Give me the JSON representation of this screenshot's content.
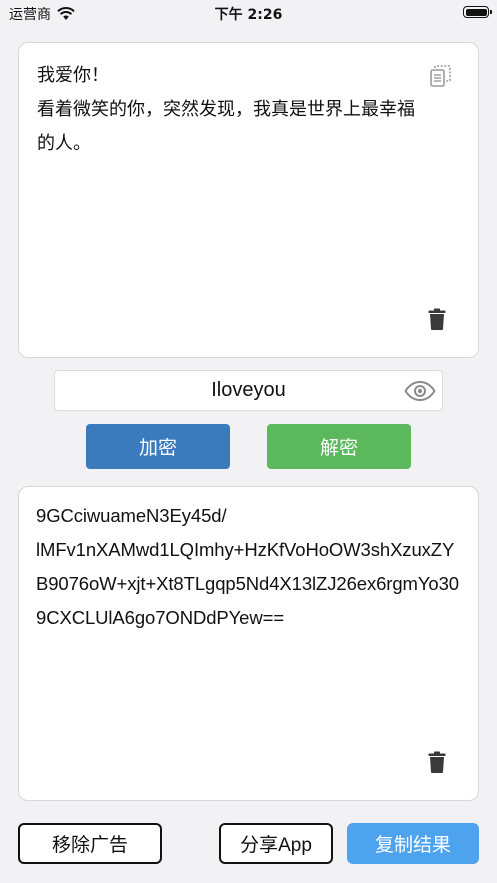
{
  "status_bar": {
    "carrier": "运营商",
    "time": "下午 2:26"
  },
  "input": {
    "text": "我爱你！\n看着微笑的你，突然发现，我真是世界上最幸福的人。",
    "copy_icon": "copy-icon",
    "delete_icon": "trash-icon"
  },
  "key": {
    "value": "Iloveyou",
    "visibility_icon": "eye-icon"
  },
  "actions": {
    "encrypt_label": "加密",
    "decrypt_label": "解密"
  },
  "output": {
    "text": "9GCciwuameN3Ey45d/\nlMFv1nXAMwd1LQImhy+HzKfVoHoOW3shXzuxZYB9076oW+xjt+Xt8TLgqp5Nd4X13lZJ26ex6rgmYo309CXCLUlA6go7ONDdPYew==",
    "delete_icon": "trash-icon"
  },
  "bottom_bar": {
    "remove_ads_label": "移除广告",
    "share_app_label": "分享App",
    "copy_result_label": "复制结果"
  },
  "colors": {
    "encrypt": "#3a7bbd",
    "decrypt": "#5cb85c",
    "copy_result": "#4da3ee",
    "background": "#f2f2f4"
  }
}
